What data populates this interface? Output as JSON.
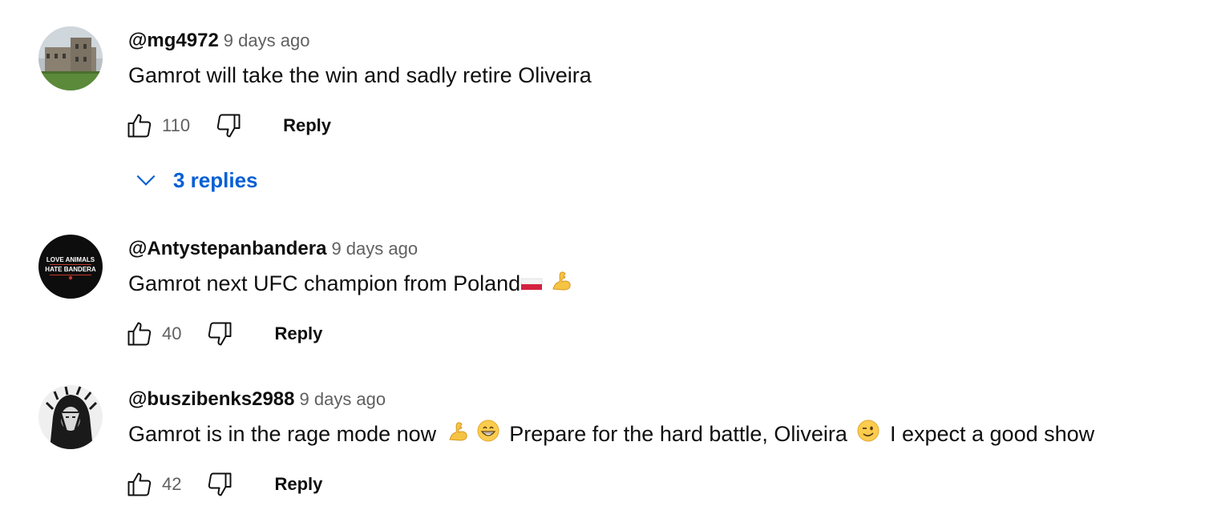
{
  "comments": [
    {
      "author": "@mg4972",
      "time": "9 days ago",
      "text": "Gamrot will take the win and sadly retire Oliveira",
      "likes": "110",
      "reply_label": "Reply",
      "replies_label": "3 replies"
    },
    {
      "author": "@Antystepanbandera",
      "time": "9 days ago",
      "text": "Gamrot next UFC champion from Poland",
      "avatar_text_line1": "LOVE ANIMALS",
      "avatar_text_line2": "HATE BANDERA",
      "likes": "40",
      "reply_label": "Reply"
    },
    {
      "author": "@buszibenks2988",
      "time": "9 days ago",
      "text_part1": "Gamrot is in the rage mode now",
      "text_part2": "Prepare for the hard battle, Oliveira",
      "text_part3": "I expect a good show",
      "likes": "42",
      "reply_label": "Reply"
    }
  ],
  "icons": {
    "like": "thumbs-up-icon",
    "dislike": "thumbs-down-icon",
    "expand": "chevron-down-icon",
    "flex": "flexed-biceps-emoji",
    "grin": "grinning-face-emoji",
    "wink": "winking-face-emoji",
    "flag": "poland-flag-emoji"
  },
  "colors": {
    "replies_link": "#065fd4",
    "secondary_text": "#606060",
    "primary_text": "#0f0f0f"
  }
}
